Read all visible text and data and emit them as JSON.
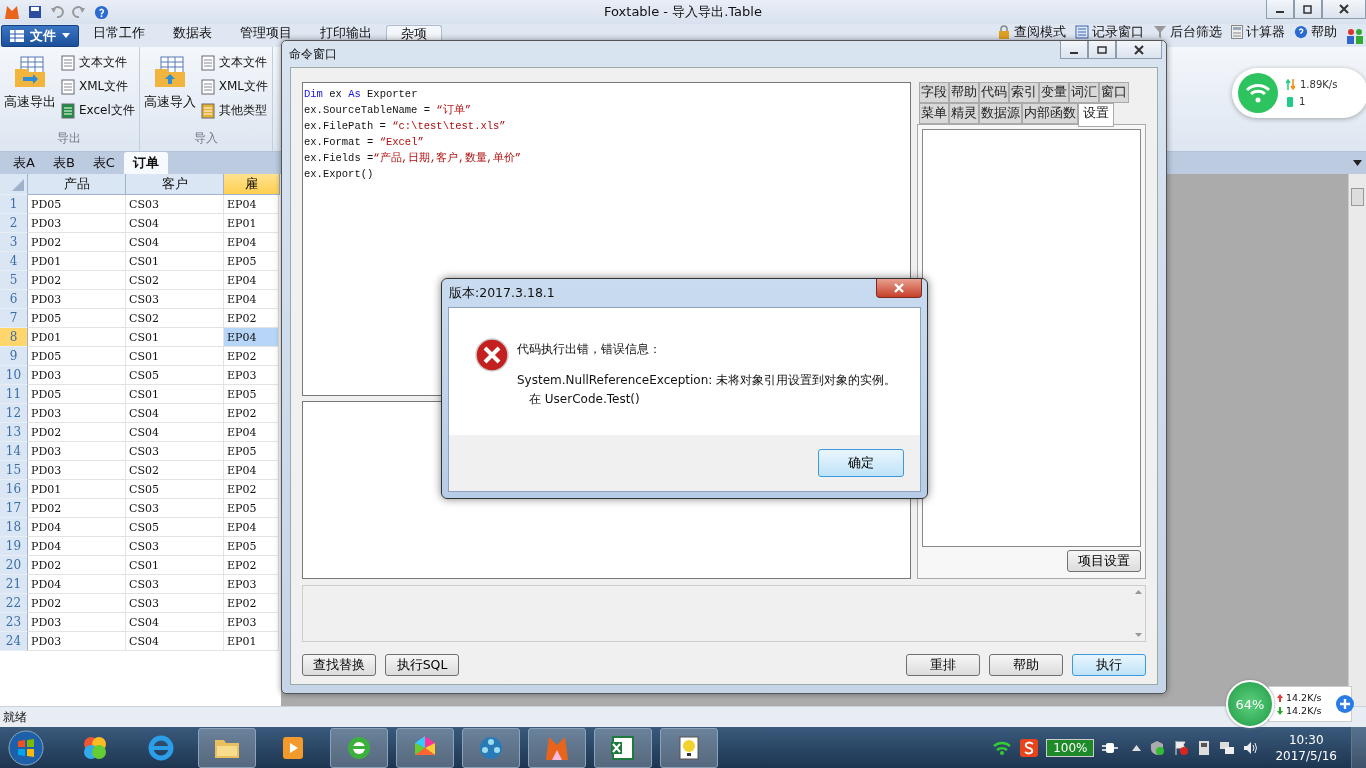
{
  "app": {
    "title": "Foxtable - 导入导出.Table",
    "file_menu": "文件",
    "menu_tabs": [
      {
        "label": "日常工作",
        "selected": false
      },
      {
        "label": "数据表",
        "selected": false
      },
      {
        "label": "管理项目",
        "selected": false
      },
      {
        "label": "打印输出",
        "selected": false
      },
      {
        "label": "杂项",
        "selected": true
      }
    ],
    "tools": [
      "查阅模式",
      "记录窗口",
      "后台筛选",
      "计算器",
      "帮助"
    ],
    "ribbon_groups": [
      {
        "name": "导出",
        "big_button": "高速导出",
        "items": [
          "文本文件",
          "XML文件",
          "Excel文件"
        ]
      },
      {
        "name": "导入",
        "big_button": "高速导入",
        "items": [
          "文本文件",
          "XML文件",
          "其他类型"
        ]
      }
    ],
    "sheet_tabs": [
      {
        "label": "表A",
        "selected": false
      },
      {
        "label": "表B",
        "selected": false
      },
      {
        "label": "表C",
        "selected": false
      },
      {
        "label": "订单",
        "selected": true
      }
    ],
    "grid": {
      "columns": [
        {
          "label": "产品",
          "selected": false
        },
        {
          "label": "客户",
          "selected": false
        },
        {
          "label": "雇",
          "selected": true
        }
      ],
      "rows": [
        {
          "number": "1",
          "cells": [
            "PD05",
            "CS03",
            "EP04"
          ],
          "selected": false
        },
        {
          "number": "2",
          "cells": [
            "PD03",
            "CS04",
            "EP01"
          ],
          "selected": false
        },
        {
          "number": "3",
          "cells": [
            "PD02",
            "CS04",
            "EP04"
          ],
          "selected": false
        },
        {
          "number": "4",
          "cells": [
            "PD01",
            "CS01",
            "EP05"
          ],
          "selected": false
        },
        {
          "number": "5",
          "cells": [
            "PD02",
            "CS02",
            "EP04"
          ],
          "selected": false
        },
        {
          "number": "6",
          "cells": [
            "PD03",
            "CS03",
            "EP04"
          ],
          "selected": false
        },
        {
          "number": "7",
          "cells": [
            "PD05",
            "CS02",
            "EP02"
          ],
          "selected": false
        },
        {
          "number": "8",
          "cells": [
            "PD01",
            "CS01",
            "EP04"
          ],
          "selected": true
        },
        {
          "number": "9",
          "cells": [
            "PD05",
            "CS01",
            "EP02"
          ],
          "selected": false
        },
        {
          "number": "10",
          "cells": [
            "PD03",
            "CS05",
            "EP03"
          ],
          "selected": false
        },
        {
          "number": "11",
          "cells": [
            "PD05",
            "CS01",
            "EP05"
          ],
          "selected": false
        },
        {
          "number": "12",
          "cells": [
            "PD03",
            "CS04",
            "EP02"
          ],
          "selected": false
        },
        {
          "number": "13",
          "cells": [
            "PD02",
            "CS04",
            "EP04"
          ],
          "selected": false
        },
        {
          "number": "14",
          "cells": [
            "PD03",
            "CS03",
            "EP05"
          ],
          "selected": false
        },
        {
          "number": "15",
          "cells": [
            "PD03",
            "CS02",
            "EP04"
          ],
          "selected": false
        },
        {
          "number": "16",
          "cells": [
            "PD01",
            "CS05",
            "EP02"
          ],
          "selected": false
        },
        {
          "number": "17",
          "cells": [
            "PD02",
            "CS03",
            "EP05"
          ],
          "selected": false
        },
        {
          "number": "18",
          "cells": [
            "PD04",
            "CS05",
            "EP04"
          ],
          "selected": false
        },
        {
          "number": "19",
          "cells": [
            "PD04",
            "CS03",
            "EP05"
          ],
          "selected": false
        },
        {
          "number": "20",
          "cells": [
            "PD02",
            "CS01",
            "EP02"
          ],
          "selected": false
        },
        {
          "number": "21",
          "cells": [
            "PD04",
            "CS03",
            "EP03"
          ],
          "selected": false
        },
        {
          "number": "22",
          "cells": [
            "PD02",
            "CS03",
            "EP02"
          ],
          "selected": false
        },
        {
          "number": "23",
          "cells": [
            "PD03",
            "CS04",
            "EP03"
          ],
          "selected": false
        },
        {
          "number": "24",
          "cells": [
            "PD03",
            "CS04",
            "EP01"
          ],
          "selected": false
        }
      ]
    },
    "status": "就绪"
  },
  "command_window": {
    "title": "命令窗口",
    "code_lines": [
      [
        {
          "text": "Dim",
          "kind": "keyword"
        },
        {
          "text": " ex ",
          "kind": "plain"
        },
        {
          "text": "As",
          "kind": "keyword"
        },
        {
          "text": " Exporter",
          "kind": "plain"
        }
      ],
      [
        {
          "text": "ex.SourceTableName = ",
          "kind": "plain"
        },
        {
          "text": "“订单”",
          "kind": "string"
        }
      ],
      [
        {
          "text": "ex.FilePath = ",
          "kind": "plain"
        },
        {
          "text": "“c:\\test\\test.xls”",
          "kind": "string"
        }
      ],
      [
        {
          "text": "ex.Format = ",
          "kind": "plain"
        },
        {
          "text": "“Excel”",
          "kind": "string"
        }
      ],
      [
        {
          "text": "ex.Fields =",
          "kind": "plain"
        },
        {
          "text": "“产品,日期,客户,数量,单价”",
          "kind": "string"
        }
      ],
      [
        {
          "text": "ex.Export()",
          "kind": "plain"
        }
      ]
    ],
    "tab_rows": [
      [
        {
          "label": "字段",
          "selected": false
        },
        {
          "label": "帮助",
          "selected": false
        },
        {
          "label": "代码",
          "selected": false
        },
        {
          "label": "索引",
          "selected": false
        },
        {
          "label": "变量",
          "selected": false
        },
        {
          "label": "词汇",
          "selected": false
        },
        {
          "label": "窗口",
          "selected": false
        }
      ],
      [
        {
          "label": "菜单",
          "selected": false
        },
        {
          "label": "精灵",
          "selected": false
        },
        {
          "label": "数据源",
          "selected": false
        },
        {
          "label": "内部函数",
          "selected": false
        },
        {
          "label": "设置",
          "selected": true
        }
      ]
    ],
    "settings_button": "项目设置",
    "left_buttons": [
      "查找替换",
      "执行SQL"
    ],
    "right_buttons": [
      {
        "label": "重排",
        "default": false
      },
      {
        "label": "帮助",
        "default": false
      },
      {
        "label": "执行",
        "default": true
      }
    ]
  },
  "dialog": {
    "title": "版本:2017.3.18.1",
    "heading": "代码执行出错，错误信息：",
    "message_lines": [
      "System.NullReferenceException: 未将对象引用设置到对象的实例。",
      "在 UserCode.Test()"
    ],
    "ok_button": "确定"
  },
  "network_widget": {
    "speed": "1.89K/s",
    "count": "1"
  },
  "speed_meter": {
    "percent": "64%",
    "upload": "14.2K/s",
    "download": "14.2K/s"
  },
  "taskbar": {
    "battery": "100%",
    "time": "10:30",
    "date": "2017/5/16"
  }
}
